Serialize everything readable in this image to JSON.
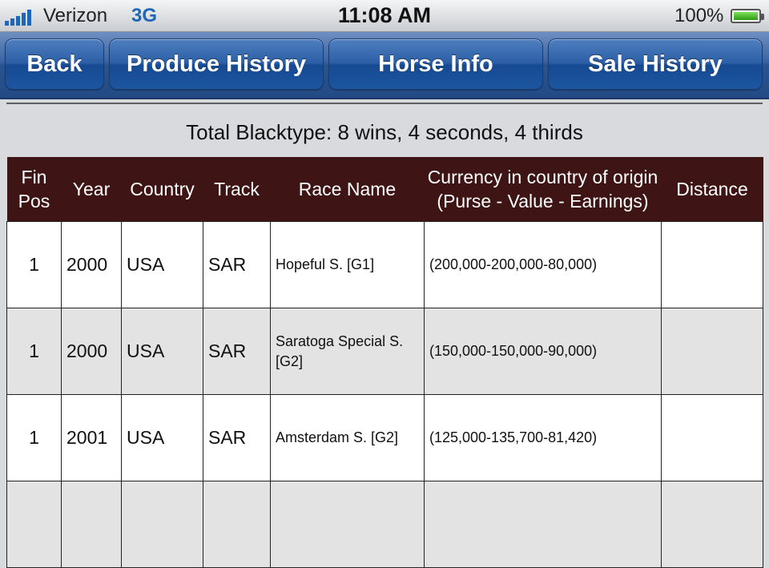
{
  "status_bar": {
    "carrier": "Verizon",
    "network": "3G",
    "time": "11:08 AM",
    "battery": "100%"
  },
  "nav": {
    "back": "Back",
    "produce_history": "Produce History",
    "horse_info": "Horse Info",
    "sale_history": "Sale History"
  },
  "summary": "Total Blacktype: 8 wins, 4 seconds, 4 thirds",
  "table": {
    "headers": {
      "fin_pos_1": "Fin",
      "fin_pos_2": "Pos",
      "year": "Year",
      "country": "Country",
      "track": "Track",
      "race_name": "Race Name",
      "currency_1": "Currency in country of origin",
      "currency_2": "(Purse - Value - Earnings)",
      "distance": "Distance"
    },
    "rows": [
      {
        "fin_pos": "1",
        "year": "2000",
        "country": "USA",
        "track": "SAR",
        "race_name": "Hopeful S. [G1]",
        "currency": "(200,000-200,000-80,000)",
        "distance": ""
      },
      {
        "fin_pos": "1",
        "year": "2000",
        "country": "USA",
        "track": "SAR",
        "race_name": "Saratoga Special S. [G2]",
        "currency": "(150,000-150,000-90,000)",
        "distance": ""
      },
      {
        "fin_pos": "1",
        "year": "2001",
        "country": "USA",
        "track": "SAR",
        "race_name": "Amsterdam S. [G2]",
        "currency": "(125,000-135,700-81,420)",
        "distance": ""
      },
      {
        "fin_pos": "",
        "year": "",
        "country": "",
        "track": "",
        "race_name": "",
        "currency": "",
        "distance": ""
      }
    ]
  },
  "colors": {
    "header_bg": "#3e1414",
    "nav_blue": "#2b5ea5",
    "network_blue": "#1f67b8"
  }
}
